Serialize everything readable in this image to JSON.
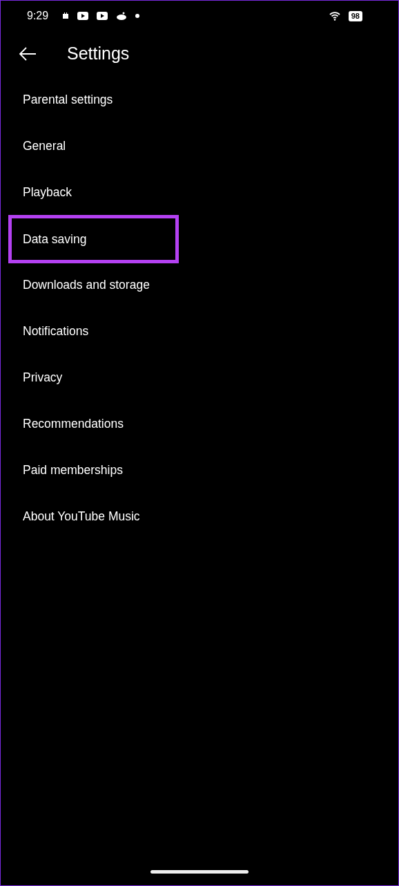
{
  "status_bar": {
    "time": "9:29",
    "battery": "98"
  },
  "header": {
    "title": "Settings"
  },
  "items": [
    {
      "label": "Parental settings",
      "highlighted": false
    },
    {
      "label": "General",
      "highlighted": false
    },
    {
      "label": "Playback",
      "highlighted": false
    },
    {
      "label": "Data saving",
      "highlighted": true
    },
    {
      "label": "Downloads and storage",
      "highlighted": false
    },
    {
      "label": "Notifications",
      "highlighted": false
    },
    {
      "label": "Privacy",
      "highlighted": false
    },
    {
      "label": "Recommendations",
      "highlighted": false
    },
    {
      "label": "Paid memberships",
      "highlighted": false
    },
    {
      "label": "About YouTube Music",
      "highlighted": false
    }
  ]
}
